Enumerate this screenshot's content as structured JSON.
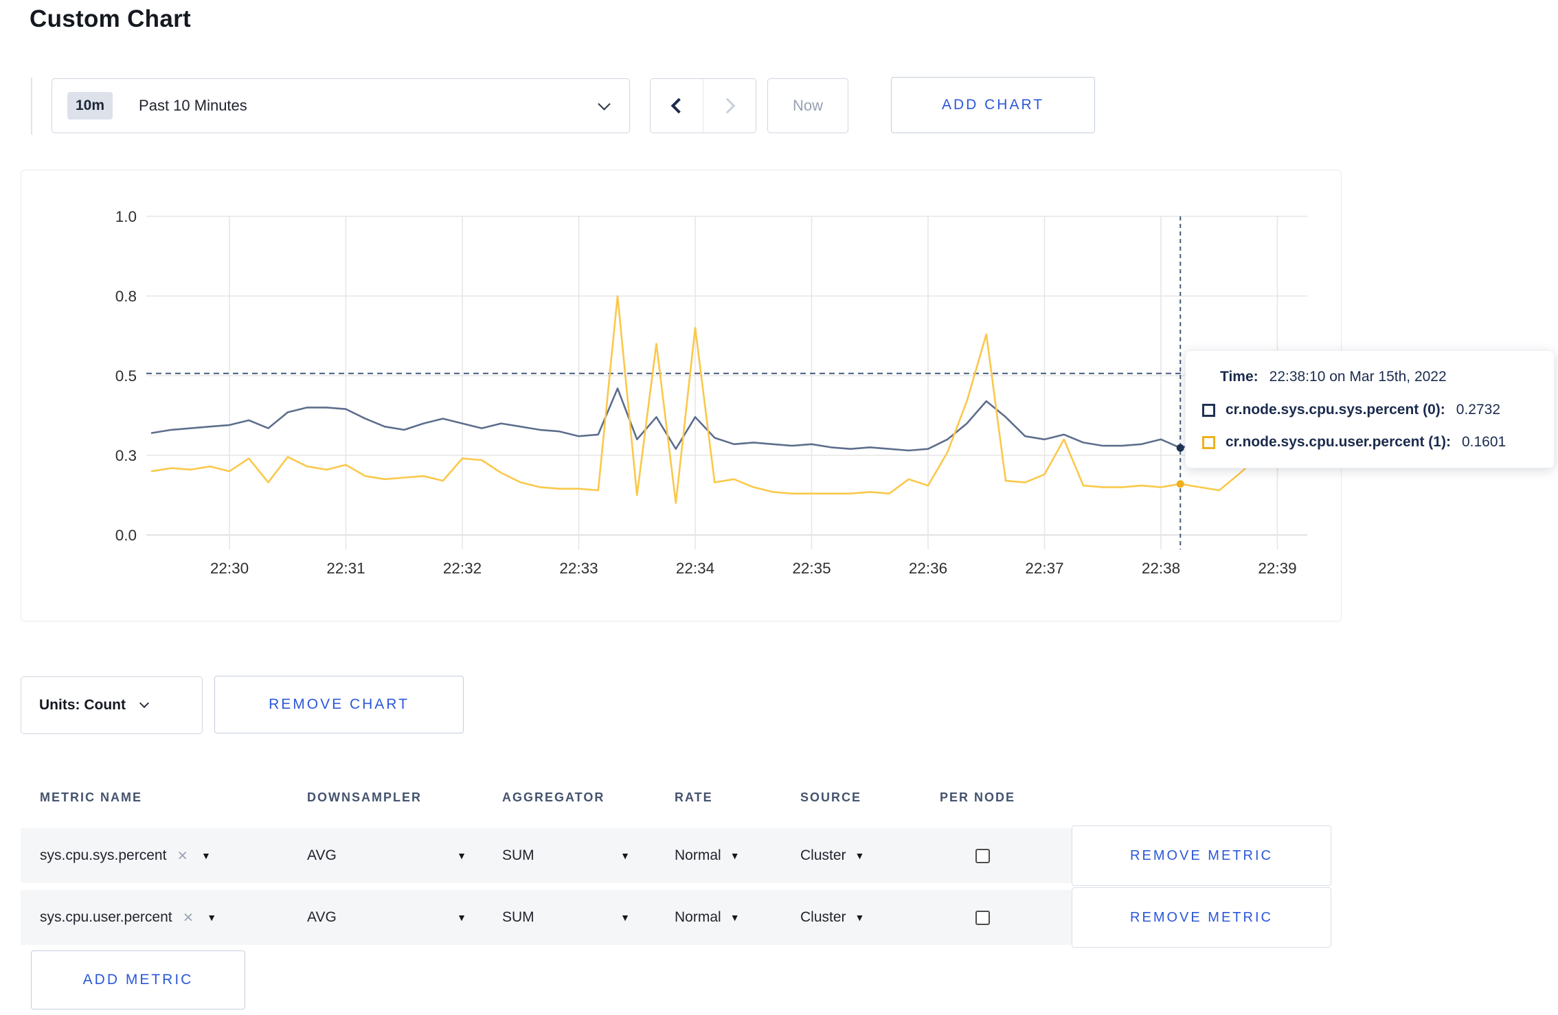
{
  "page": {
    "title": "Custom Chart"
  },
  "toolbar": {
    "range_badge": "10m",
    "range_label": "Past 10 Minutes",
    "now_label": "Now",
    "add_chart_label": "ADD CHART"
  },
  "icons": {
    "dropdown_arrow": "▼",
    "close_x": "×"
  },
  "colors": {
    "accent": "#2b57d8",
    "grid": "#e6e6e6",
    "axis_text": "#2e2e2e",
    "crosshair": "#44597c"
  },
  "chart_data": {
    "type": "line",
    "title": "",
    "xlabel": "",
    "ylabel": "",
    "x_start": "22:29:20",
    "x_interval_seconds": 10,
    "x_ticks": [
      "22:30",
      "22:31",
      "22:32",
      "22:33",
      "22:34",
      "22:35",
      "22:36",
      "22:37",
      "22:38",
      "22:39"
    ],
    "ylim": [
      0,
      1
    ],
    "y_tick_values": [
      0,
      0.25,
      0.5,
      0.75,
      1.0
    ],
    "y_tick_labels": [
      "0.0",
      "0.3",
      "0.5",
      "0.8",
      "1.0"
    ],
    "grid": true,
    "legend_position": "tooltip",
    "reference_line_value": 0.507,
    "crosshair": {
      "time": "22:38:10",
      "seconds_after_22_30": 490
    },
    "series": [
      {
        "name": "cr.node.sys.cpu.sys.percent",
        "color": "#5d6e8c",
        "swatch_color": "#1f3254",
        "highlight_value": 0.2732,
        "values": [
          0.32,
          0.33,
          0.335,
          0.34,
          0.345,
          0.36,
          0.335,
          0.385,
          0.4,
          0.4,
          0.395,
          0.365,
          0.34,
          0.33,
          0.35,
          0.365,
          0.35,
          0.335,
          0.35,
          0.34,
          0.33,
          0.325,
          0.31,
          0.315,
          0.46,
          0.3,
          0.37,
          0.27,
          0.37,
          0.305,
          0.285,
          0.29,
          0.285,
          0.28,
          0.285,
          0.275,
          0.27,
          0.275,
          0.27,
          0.265,
          0.27,
          0.3,
          0.35,
          0.42,
          0.37,
          0.31,
          0.3,
          0.315,
          0.29,
          0.28,
          0.28,
          0.285,
          0.3,
          0.2732,
          0.29,
          0.3,
          0.305,
          0.3,
          0.3
        ]
      },
      {
        "name": "cr.node.sys.cpu.user.percent",
        "color": "#fac84a",
        "swatch_color": "#efb01e",
        "highlight_value": 0.1601,
        "values": [
          0.2,
          0.21,
          0.205,
          0.215,
          0.2,
          0.24,
          0.165,
          0.245,
          0.215,
          0.205,
          0.22,
          0.185,
          0.175,
          0.18,
          0.185,
          0.17,
          0.24,
          0.235,
          0.195,
          0.165,
          0.15,
          0.145,
          0.145,
          0.14,
          0.75,
          0.125,
          0.6,
          0.1,
          0.65,
          0.165,
          0.175,
          0.15,
          0.135,
          0.13,
          0.13,
          0.13,
          0.13,
          0.135,
          0.13,
          0.175,
          0.155,
          0.26,
          0.42,
          0.63,
          0.17,
          0.165,
          0.19,
          0.3,
          0.155,
          0.15,
          0.15,
          0.155,
          0.15,
          0.1601,
          0.15,
          0.14,
          0.19,
          0.245,
          0.21
        ]
      }
    ]
  },
  "tooltip": {
    "time_label": "Time:",
    "time_value": "22:38:10 on Mar 15th, 2022",
    "rows": [
      {
        "label": "cr.node.sys.cpu.sys.percent (0):",
        "value": "0.2732"
      },
      {
        "label": "cr.node.sys.cpu.user.percent (1):",
        "value": "0.1601"
      }
    ]
  },
  "units": {
    "label": "Units: Count"
  },
  "remove_chart_label": "REMOVE CHART",
  "metrics_table": {
    "headers": [
      "METRIC NAME",
      "DOWNSAMPLER",
      "AGGREGATOR",
      "RATE",
      "SOURCE",
      "PER NODE"
    ],
    "rows": [
      {
        "metric": "sys.cpu.sys.percent",
        "downsampler": "AVG",
        "aggregator": "SUM",
        "rate": "Normal",
        "source": "Cluster",
        "per_node_checked": false,
        "remove_label": "REMOVE METRIC"
      },
      {
        "metric": "sys.cpu.user.percent",
        "downsampler": "AVG",
        "aggregator": "SUM",
        "rate": "Normal",
        "source": "Cluster",
        "per_node_checked": false,
        "remove_label": "REMOVE METRIC"
      }
    ],
    "add_metric_label": "ADD METRIC"
  }
}
